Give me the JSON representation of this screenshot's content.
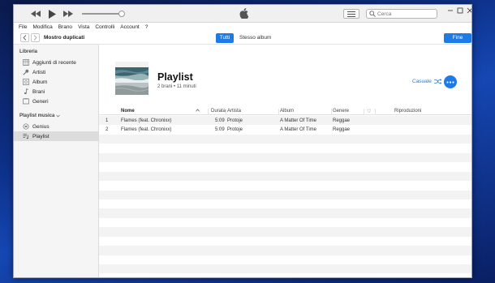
{
  "window": {
    "player": {
      "search_placeholder": "Cerca"
    },
    "menu": [
      "File",
      "Modifica",
      "Brano",
      "Vista",
      "Controlli",
      "Account",
      "?"
    ],
    "nav": {
      "title": "Mostro duplicati",
      "segment_all": "Tutti",
      "segment_album": "Stesso album",
      "done": "Fine"
    },
    "sidebar": {
      "library_header": "Libreria",
      "library_items": [
        {
          "label": "Aggiunti di recente",
          "icon": "recently-added-icon"
        },
        {
          "label": "Artisti",
          "icon": "microphone-icon"
        },
        {
          "label": "Album",
          "icon": "album-icon"
        },
        {
          "label": "Brani",
          "icon": "music-note-icon"
        },
        {
          "label": "Generi",
          "icon": "genres-icon"
        }
      ],
      "playlist_header": "Playlist musica",
      "playlist_items": [
        {
          "label": "Genius",
          "icon": "genius-icon"
        },
        {
          "label": "Playlist",
          "icon": "playlist-icon",
          "active": true
        }
      ]
    },
    "playlist": {
      "title": "Playlist",
      "subtitle": "2 brani • 11 minuti",
      "shuffle_label": "Casuale"
    },
    "table": {
      "columns": [
        "Nome",
        "Durata",
        "Artista",
        "Album",
        "Genere",
        "♡",
        "Riproduzioni"
      ],
      "rows": [
        {
          "num": "1",
          "name": "Flames (feat. Chronixx)",
          "duration": "5:09",
          "artist": "Protoje",
          "album": "A Matter Of Time",
          "genre": "Reggae"
        },
        {
          "num": "2",
          "name": "Flames (feat. Chronixx)",
          "duration": "5:09",
          "artist": "Protoje",
          "album": "A Matter Of Time",
          "genre": "Reggae"
        }
      ]
    },
    "colors": {
      "accent": "#1e7be6",
      "stripe": "#f3f3f3",
      "sidebar_bg": "#f5f5f5",
      "desktop": "#0d2f86"
    }
  }
}
